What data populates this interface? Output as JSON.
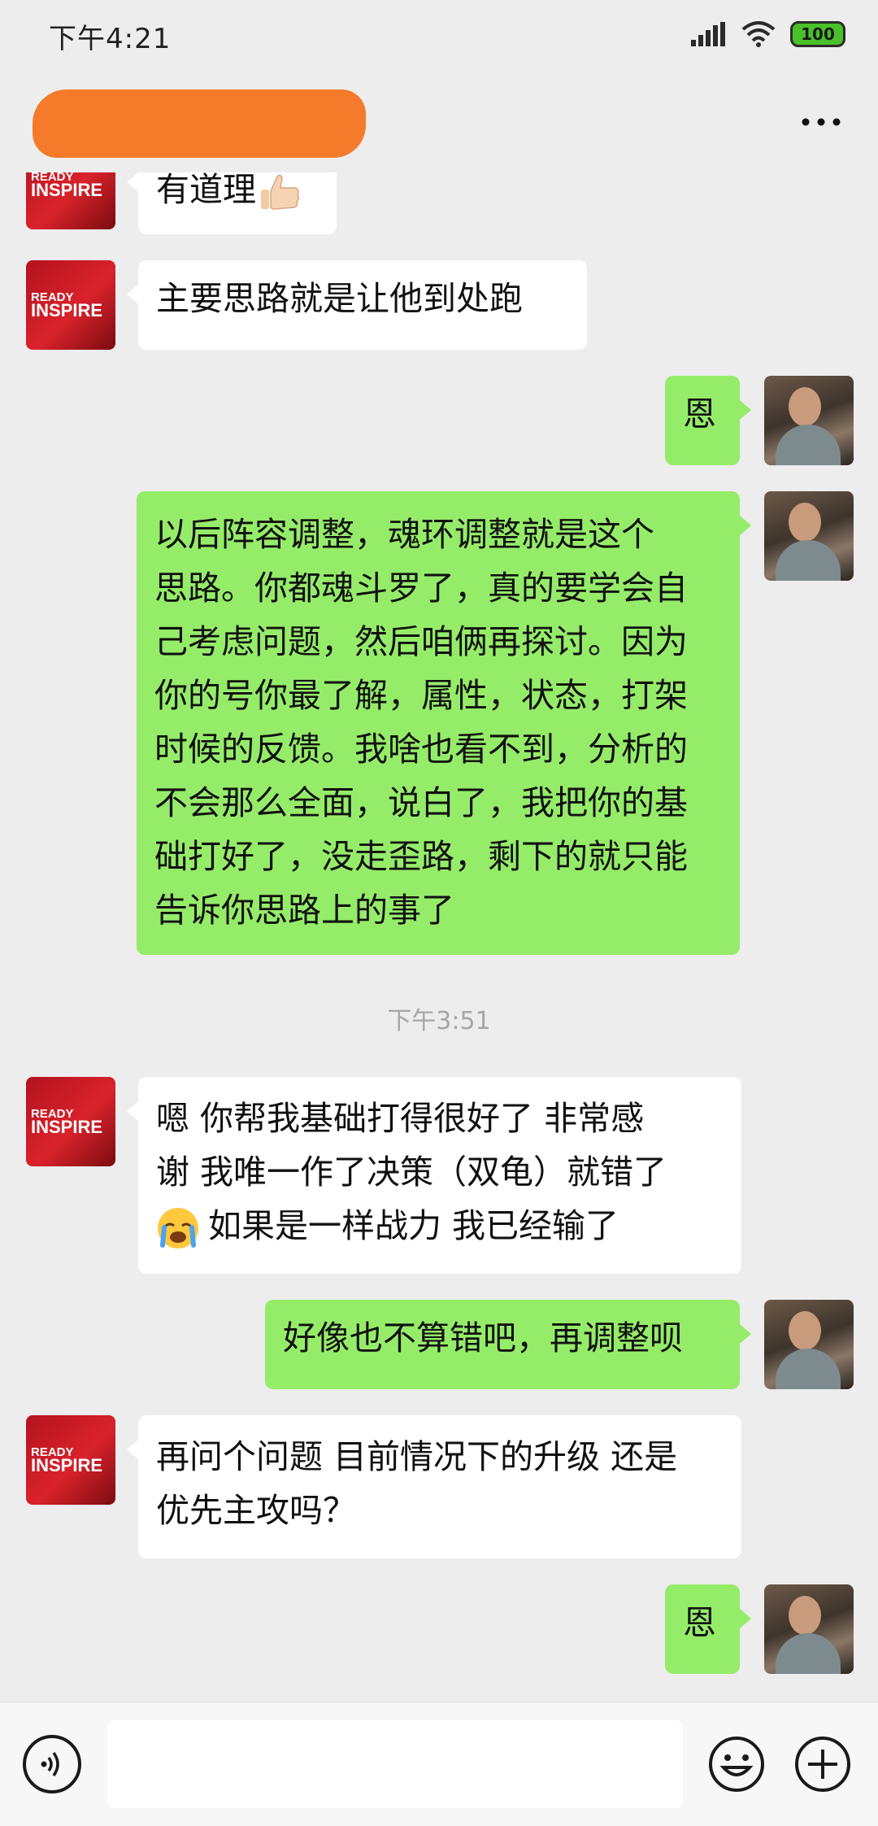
{
  "status_bar": {
    "time": "下午4:21",
    "battery": "100",
    "signal_icon": "signal-icon",
    "wifi_icon": "wifi-icon"
  },
  "header": {
    "more_label": "···"
  },
  "messages": [
    {
      "sender": "other",
      "text": "有道理",
      "emoji": "thumbs-up"
    },
    {
      "sender": "other",
      "text": "主要思路就是让他到处跑"
    },
    {
      "sender": "self",
      "text": "恩"
    },
    {
      "sender": "self",
      "lines": [
        "以后阵容调整，魂环调整就是这个",
        "思路。你都魂斗罗了，真的要学会自",
        "己考虑问题，然后咱俩再探讨。因为",
        "你的号你最了解，属性，状态，打架",
        "时候的反馈。我啥也看不到，分析的",
        "不会那么全面，说白了，我把你的基",
        "础打好了，没走歪路，剩下的就只能",
        "告诉你思路上的事了"
      ]
    },
    {
      "sender": "time",
      "text": "下午3:51"
    },
    {
      "sender": "other",
      "lines": [
        "嗯 你帮我基础打得很好了 非常感",
        "谢 我唯一作了决策（双龟）就错了",
        "如果是一样战力 我已经输了"
      ],
      "emoji": "crying-face"
    },
    {
      "sender": "self",
      "text": "好像也不算错吧，再调整呗"
    },
    {
      "sender": "other",
      "lines": [
        "再问个问题 目前情况下的升级 还是",
        "优先主攻吗？"
      ]
    },
    {
      "sender": "self",
      "text": "恩"
    }
  ],
  "avatar_brand": {
    "line1": "READY",
    "line2": "TO",
    "line3": "INSPIRE"
  },
  "input_bar": {
    "voice_icon": "voice-icon",
    "emoji_icon": "emoji-icon",
    "plus_icon": "plus-icon",
    "placeholder": ""
  }
}
